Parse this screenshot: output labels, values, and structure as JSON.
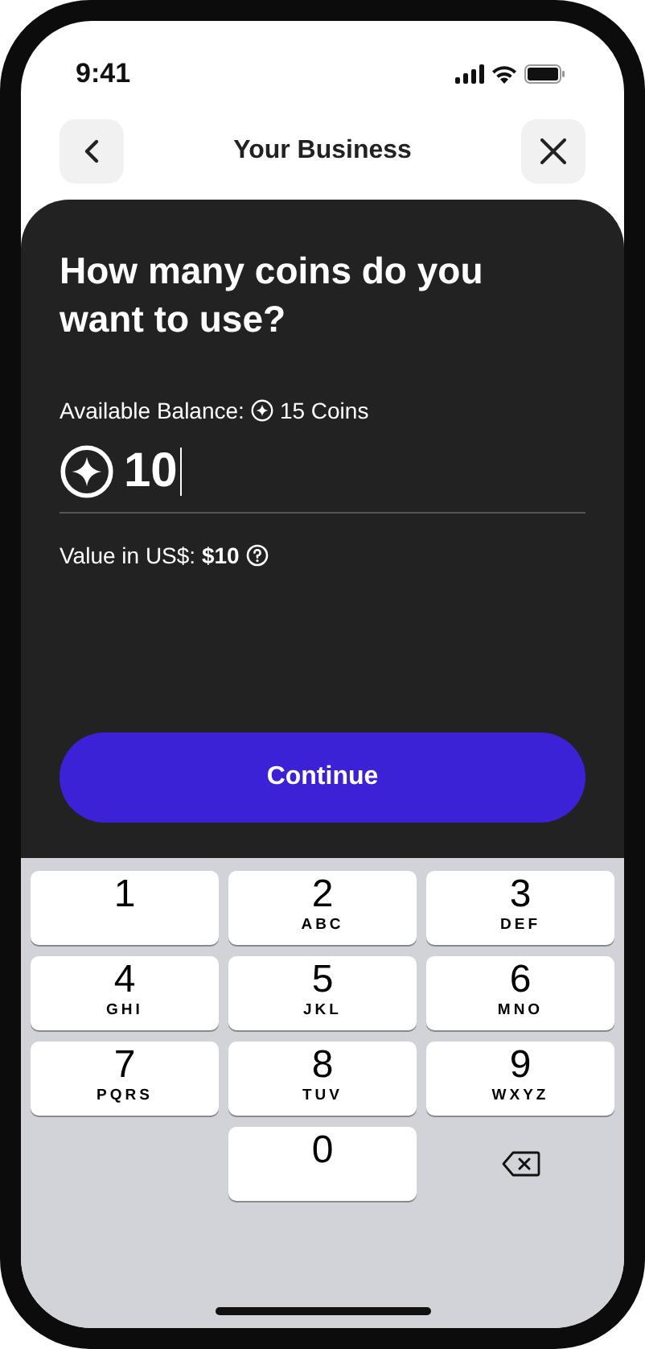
{
  "status_bar": {
    "time": "9:41"
  },
  "header": {
    "title": "Your Business"
  },
  "question": "How many coins do you want to use?",
  "balance": {
    "label": "Available Balance:",
    "amount": "15 Coins"
  },
  "amount_field": {
    "value": "10"
  },
  "value_line": "Value in US$: **$10**",
  "continue_button": "Continue",
  "keypad": [
    {
      "kind": "key",
      "digit": "1"
    },
    {
      "kind": "key",
      "digit": "2",
      "letters": "ABC"
    },
    {
      "kind": "key",
      "digit": "3",
      "letters": "DEF"
    },
    {
      "kind": "key",
      "digit": "4",
      "letters": "GHI"
    },
    {
      "kind": "key",
      "digit": "5",
      "letters": "JKL"
    },
    {
      "kind": "key",
      "digit": "6",
      "letters": "MNO"
    },
    {
      "kind": "key",
      "digit": "7",
      "letters": "PQRS"
    },
    {
      "kind": "key",
      "digit": "8",
      "letters": "TUV"
    },
    {
      "kind": "key",
      "digit": "9",
      "letters": "WXYZ"
    },
    {
      "kind": "blank"
    },
    {
      "kind": "key",
      "digit": "0"
    },
    {
      "kind": "delete"
    }
  ]
}
